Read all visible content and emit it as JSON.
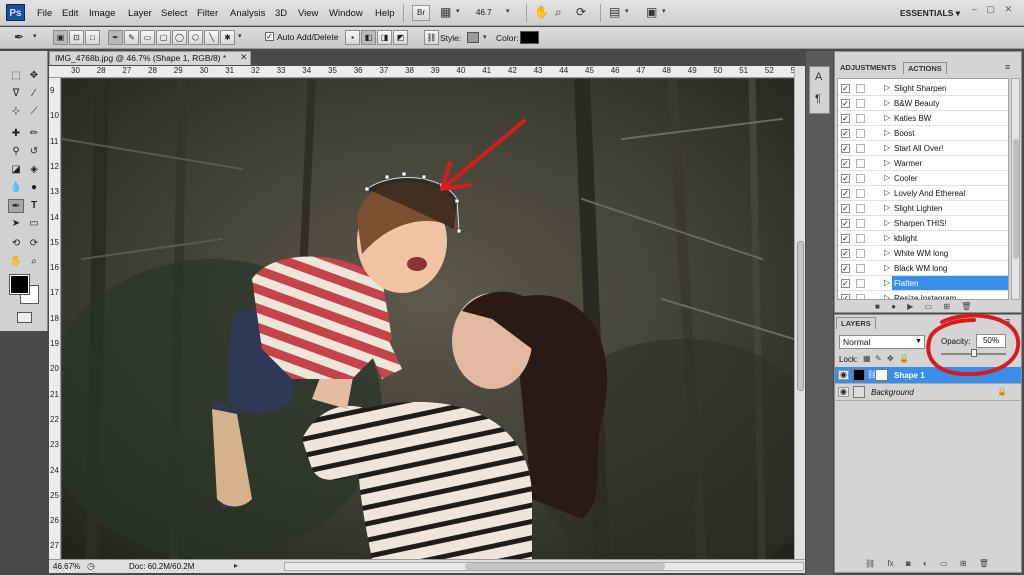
{
  "app": {
    "logo": "Ps",
    "workspace": "ESSENTIALS ▾"
  },
  "menu": [
    "File",
    "Edit",
    "Image",
    "Layer",
    "Select",
    "Filter",
    "Analysis",
    "3D",
    "View",
    "Window",
    "Help"
  ],
  "menubar": {
    "bridge_label": "Br",
    "zoom_value": "46.7",
    "win_controls": [
      "–",
      "▢",
      "✕"
    ]
  },
  "options_bar": {
    "auto_add_delete": "Auto Add/Delete",
    "auto_add_checked": true,
    "style_label": "Style:",
    "color_label": "Color:",
    "color_value": "#000000"
  },
  "document": {
    "tab_title": "IMG_4768b.jpg @ 46.7% (Shape 1, RGB/8) *",
    "ruler_h": [
      "30",
      "28",
      "27",
      "28",
      "29",
      "30",
      "31",
      "32",
      "33",
      "34",
      "35",
      "36",
      "37",
      "38",
      "39",
      "40",
      "41",
      "42",
      "43",
      "44",
      "45",
      "46",
      "47",
      "48",
      "49",
      "50",
      "51",
      "52",
      "53"
    ],
    "ruler_v": [
      "9",
      "10",
      "11",
      "12",
      "13",
      "14",
      "15",
      "16",
      "17",
      "18",
      "19",
      "20",
      "21",
      "22",
      "23",
      "24",
      "25",
      "26",
      "27"
    ],
    "zoom_status": "46.67%",
    "doc_status": "Doc: 60.2M/60.2M"
  },
  "actions_panel": {
    "tabs": [
      "ADJUSTMENTS",
      "ACTIONS"
    ],
    "active_tab": "ACTIONS",
    "items": [
      {
        "label": "Slight Sharpen",
        "selected": false
      },
      {
        "label": "B&W Beauty",
        "selected": false
      },
      {
        "label": "Katies BW",
        "selected": false
      },
      {
        "label": "Boost",
        "selected": false
      },
      {
        "label": "Start All Over!",
        "selected": false
      },
      {
        "label": "Warmer",
        "selected": false
      },
      {
        "label": "Cooler",
        "selected": false
      },
      {
        "label": "Lovely And Ethereal",
        "selected": false
      },
      {
        "label": "Slight Lighten",
        "selected": false
      },
      {
        "label": "Sharpen THIS!",
        "selected": false
      },
      {
        "label": "kblight",
        "selected": false
      },
      {
        "label": "White WM long",
        "selected": false
      },
      {
        "label": "Black WM long",
        "selected": false
      },
      {
        "label": "Flatten",
        "selected": true
      },
      {
        "label": "Resize Instagram",
        "selected": false
      }
    ]
  },
  "layers_panel": {
    "title": "LAYERS",
    "blend_mode": "Normal",
    "opacity_label": "Opacity:",
    "opacity_value": "50%",
    "opacity_fraction": 0.5,
    "lock_label": "Lock:",
    "layers": [
      {
        "name": "Shape 1",
        "selected": true
      },
      {
        "name": "Background",
        "selected": false
      }
    ]
  },
  "colors": {
    "accent": "#3a8de8",
    "annotation_red": "#d81c1c",
    "foreground": "#000000",
    "background": "#ffffff"
  }
}
